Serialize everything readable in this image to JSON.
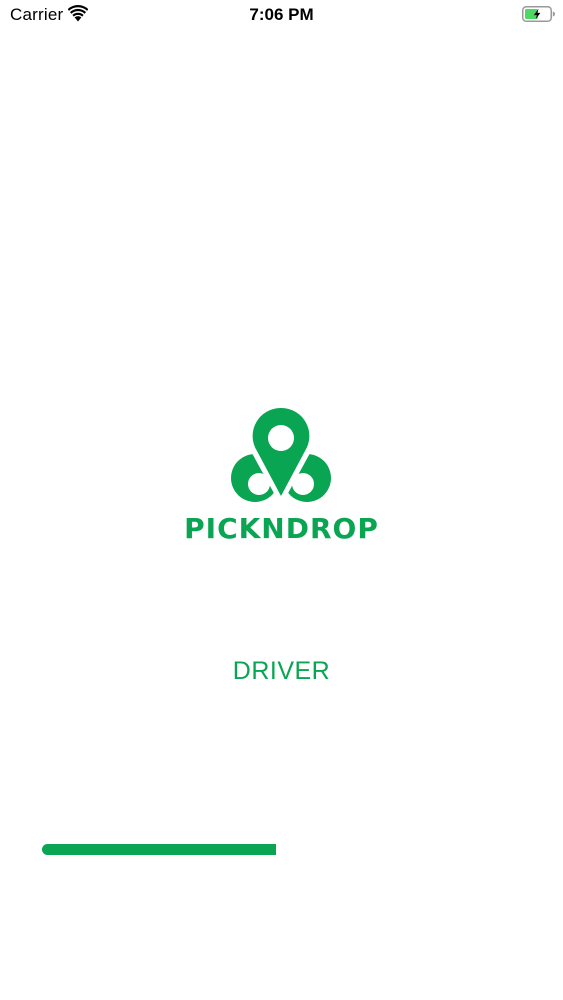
{
  "status_bar": {
    "carrier": "Carrier",
    "time": "7:06 PM",
    "wifi_icon": "wifi-icon",
    "battery_icon": "battery-charging-icon"
  },
  "splash": {
    "logo_icon": "location-pin-logo-icon",
    "brand_name": "PICKNDROP",
    "role_label": "DRIVER"
  },
  "loading": {
    "progress_fraction": 0.49
  },
  "colors": {
    "brand_green": "#0aa552",
    "battery_green": "#4cd964"
  }
}
